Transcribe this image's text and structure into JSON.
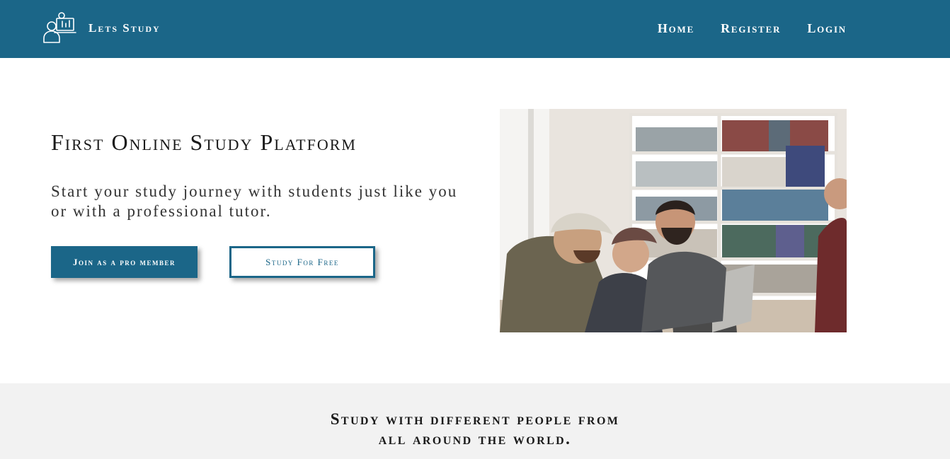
{
  "colors": {
    "brand": "#1b6688",
    "nav_text": "#ffffff",
    "section_bg": "#f2f2f2"
  },
  "navbar": {
    "logo_icon": "online-tutor-icon",
    "brand_name": "Lets Study",
    "links": [
      {
        "label": "Home"
      },
      {
        "label": "Register"
      },
      {
        "label": "Login"
      }
    ]
  },
  "hero": {
    "title": "First Online Study Platform",
    "subtitle": "Start your study journey with students just like you or with a professional tutor.",
    "primary_button": "Join as a pro member",
    "secondary_button": "Study For Free",
    "image_subject": "students laughing around laptops in a library"
  },
  "world_section": {
    "heading_line1": "Study with different people from",
    "heading_line2": "all around the world."
  }
}
